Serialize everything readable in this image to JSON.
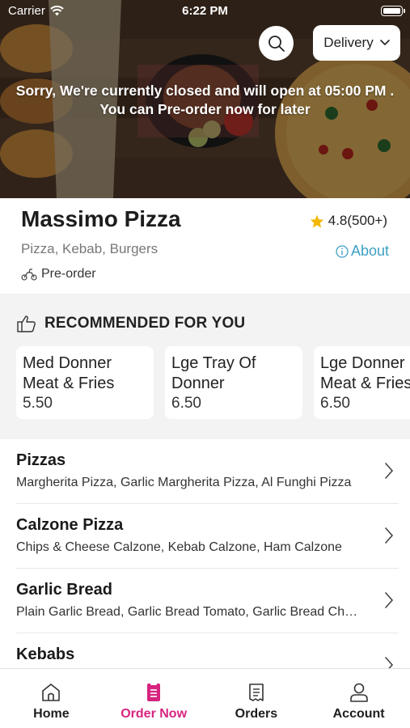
{
  "status_bar": {
    "carrier": "Carrier",
    "time": "6:22 PM"
  },
  "hero": {
    "closed_line1": "Sorry, We're currently closed and will open at 05:00 PM .",
    "closed_line2": "You can Pre-order now for later",
    "delivery_label": "Delivery",
    "search_icon": "search-icon"
  },
  "restaurant": {
    "name": "Massimo Pizza",
    "rating": "4.8(500+)",
    "cuisines": "Pizza, Kebab, Burgers",
    "about_label": "About",
    "preorder_label": "Pre-order"
  },
  "recommended": {
    "header": "RECOMMENDED FOR YOU",
    "items": [
      {
        "name": "Med Donner Meat & Fries",
        "price": "5.50"
      },
      {
        "name": "Lge Tray Of Donner",
        "price": "6.50"
      },
      {
        "name": "Lge Donner Meat & Fries",
        "price": "6.50"
      }
    ]
  },
  "categories": [
    {
      "title": "Pizzas",
      "items": "Margherita Pizza, Garlic Margherita Pizza, Al Funghi Pizza"
    },
    {
      "title": "Calzone Pizza",
      "items": "Chips & Cheese Calzone, Kebab Calzone, Ham Calzone"
    },
    {
      "title": "Garlic Bread",
      "items": "Plain Garlic Bread, Garlic Bread Tomato, Garlic Bread Cheese"
    },
    {
      "title": "Kebabs",
      "items": ""
    }
  ],
  "tabbar": {
    "tabs": [
      {
        "label": "Home",
        "icon": "home-icon"
      },
      {
        "label": "Order Now",
        "icon": "order-now-icon"
      },
      {
        "label": "Orders",
        "icon": "receipt-icon"
      },
      {
        "label": "Account",
        "icon": "person-icon"
      }
    ]
  },
  "colors": {
    "accent": "#d6247f",
    "link": "#3da0c4",
    "star": "#f2b705",
    "section_bg": "#f3f3f3"
  }
}
